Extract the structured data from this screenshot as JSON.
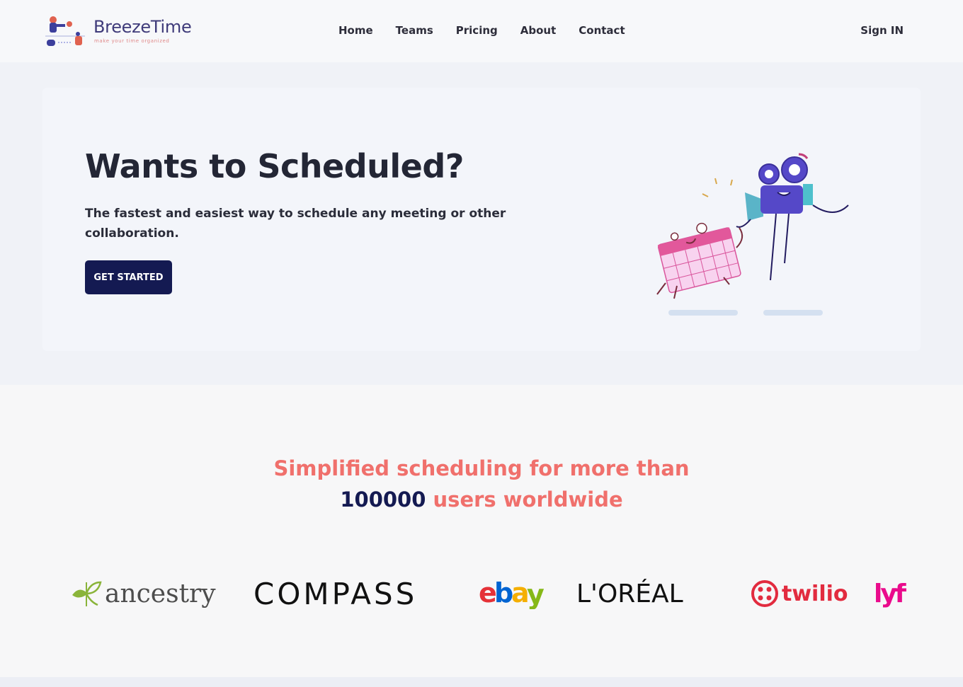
{
  "header": {
    "logo_title": "BreezeTime",
    "logo_tagline": "make your time organized",
    "nav": [
      {
        "label": "Home"
      },
      {
        "label": "Teams"
      },
      {
        "label": "Pricing"
      },
      {
        "label": "About"
      },
      {
        "label": "Contact"
      }
    ],
    "signin_label": "Sign IN"
  },
  "hero": {
    "title": "Wants to Scheduled?",
    "subtitle": "The fastest and easiest way to schedule any meeting or other collaboration.",
    "cta_label": "GET STARTED"
  },
  "stats": {
    "line1": "Simplified scheduling for more than",
    "count": "100000",
    "line2_suffix": "users worldwide"
  },
  "brands": [
    {
      "name": "ancestry",
      "icon": "ancestry-leaf-icon"
    },
    {
      "name": "COMPASS"
    },
    {
      "name": "ebay"
    },
    {
      "name": "L'ORÉAL"
    },
    {
      "name": "twilio",
      "icon": "twilio-icon"
    },
    {
      "name": "lyft"
    }
  ],
  "colors": {
    "primary": "#141a52",
    "accent": "#f0706c",
    "hero_bg": "#f0f2f7"
  }
}
